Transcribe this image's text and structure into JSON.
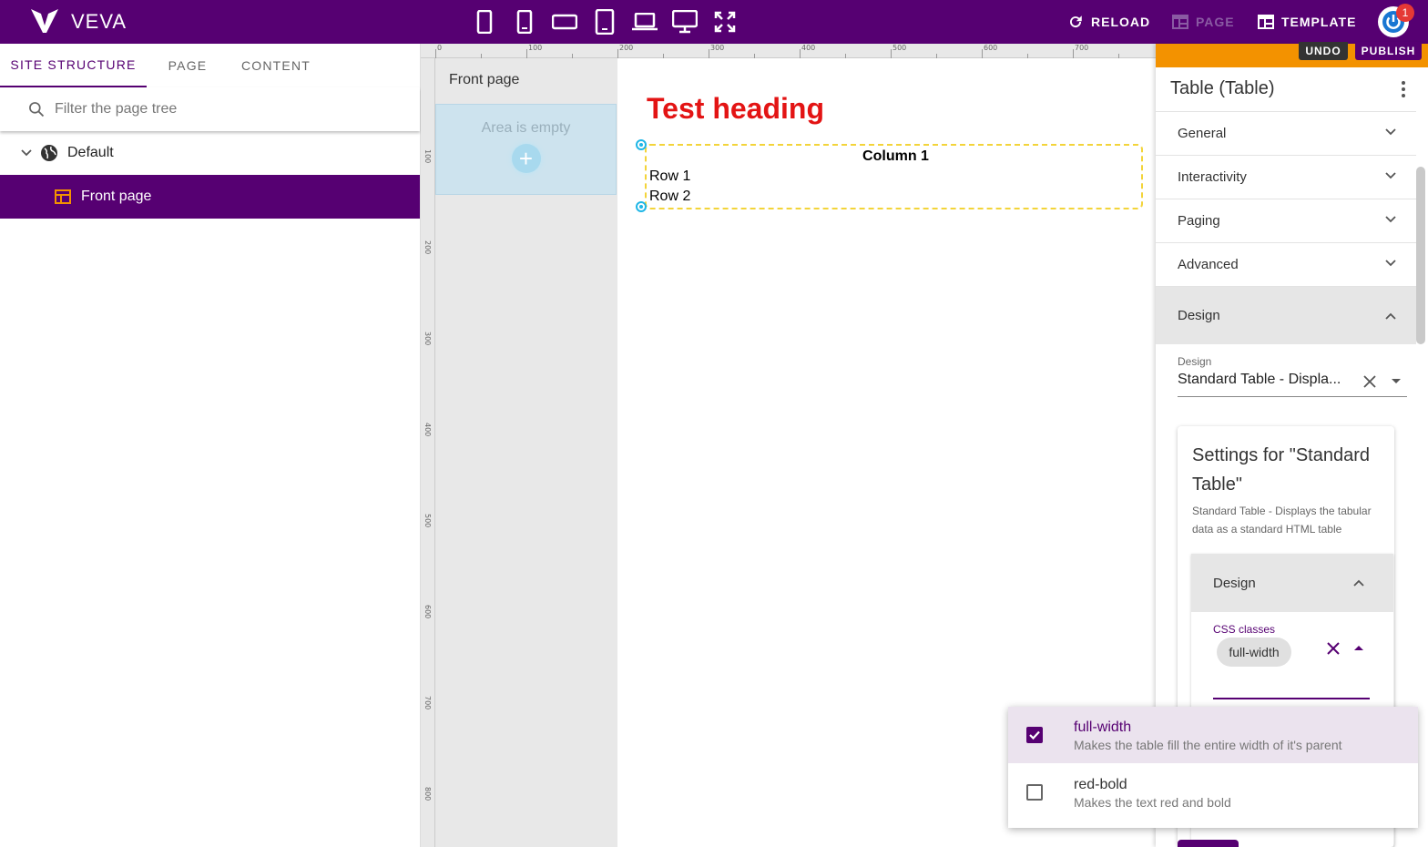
{
  "app": {
    "brand": "VEVA",
    "notification_count": "1"
  },
  "toolbar": {
    "reload_label": "RELOAD",
    "page_label": "PAGE",
    "template_label": "TEMPLATE",
    "devices": [
      "phone-portrait-icon",
      "phone-icon",
      "phone-landscape-icon",
      "tablet-icon",
      "laptop-icon",
      "desktop-icon",
      "fullscreen-icon"
    ]
  },
  "left_panel": {
    "tabs": [
      "SITE STRUCTURE",
      "PAGE",
      "CONTENT"
    ],
    "active_tab": "SITE STRUCTURE",
    "filter_placeholder": "Filter the page tree",
    "tree": {
      "root": "Default",
      "child": "Front page"
    }
  },
  "rulers": {
    "horizontal": [
      "0",
      "100",
      "200",
      "300",
      "400",
      "500",
      "600",
      "700"
    ],
    "vertical": [
      "100",
      "200",
      "300",
      "400",
      "500",
      "600",
      "700",
      "800"
    ]
  },
  "canvas": {
    "area_label": "Front page",
    "empty_text": "Area is empty",
    "heading": "Test heading",
    "table": {
      "column_header": "Column 1",
      "rows": [
        "Row 1",
        "Row 2"
      ]
    }
  },
  "right_panel": {
    "undo_label": "UNDO",
    "publish_label": "PUBLISH",
    "title": "Table (Table)",
    "sections": [
      "General",
      "Interactivity",
      "Paging",
      "Advanced",
      "Design"
    ],
    "design_field_label": "Design",
    "design_value": "Standard Table - Displa...",
    "settings_title": "Settings for \"Standard Table\"",
    "settings_desc": "Standard Table - Displays the tabular data as a standard HTML table",
    "inner_section": "Design",
    "css_label": "CSS classes",
    "css_chip": "full-width"
  },
  "dropdown": {
    "options": [
      {
        "name": "full-width",
        "desc": "Makes the table fill the entire width of it's parent",
        "checked": true
      },
      {
        "name": "red-bold",
        "desc": "Makes the text red and bold",
        "checked": false
      }
    ]
  },
  "colors": {
    "brand": "#560072",
    "accent": "#f39200",
    "heading": "#e31414",
    "selection_handle": "#1fb6e6"
  }
}
